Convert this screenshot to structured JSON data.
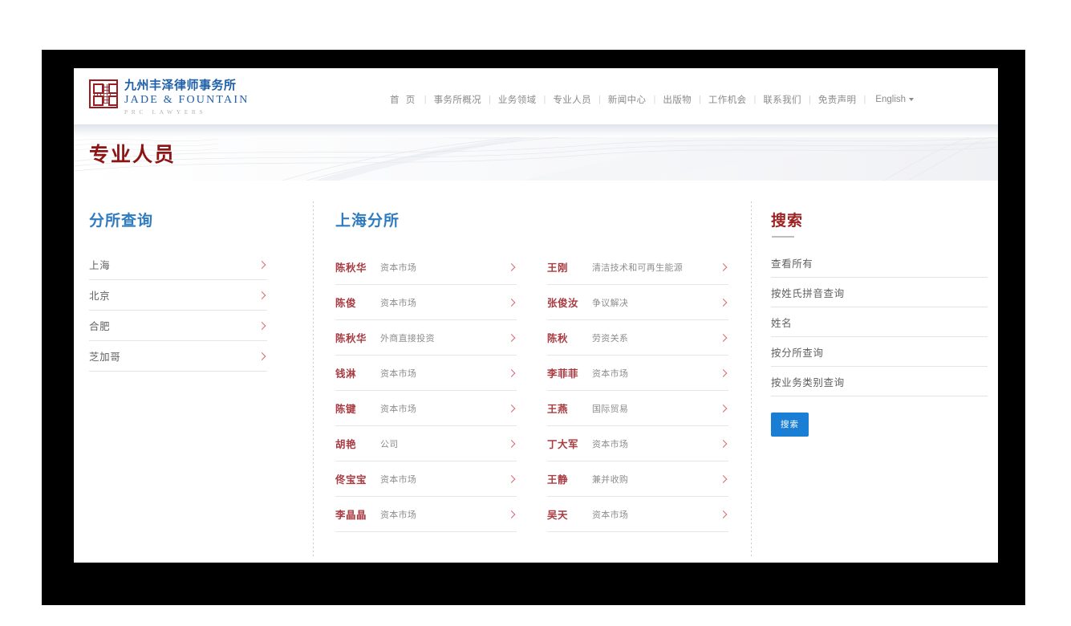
{
  "brand": {
    "seal_icon": "seal-stamp-icon",
    "name_cn": "九州丰泽律师事务所",
    "name_en": "JADE & FOUNTAIN",
    "tagline": "PRC  LAWYERS"
  },
  "nav": {
    "items": [
      {
        "label": "首 页"
      },
      {
        "label": "事务所概况"
      },
      {
        "label": "业务领域"
      },
      {
        "label": "专业人员"
      },
      {
        "label": "新闻中心"
      },
      {
        "label": "出版物"
      },
      {
        "label": "工作机会"
      },
      {
        "label": "联系我们"
      },
      {
        "label": "免责声明"
      }
    ],
    "separator": "|",
    "language": "English"
  },
  "banner": {
    "title": "专业人员"
  },
  "branch_panel": {
    "title": "分所查询",
    "items": [
      {
        "label": "上海"
      },
      {
        "label": "北京"
      },
      {
        "label": "合肥"
      },
      {
        "label": "芝加哥"
      }
    ]
  },
  "lawyers_panel": {
    "title": "上海分所",
    "column_left": [
      {
        "name": "陈秋华",
        "area": "资本市场"
      },
      {
        "name": "陈俊",
        "area": "资本市场"
      },
      {
        "name": "陈秋华",
        "area": "外商直接投资"
      },
      {
        "name": "钱淋",
        "area": "资本市场"
      },
      {
        "name": "陈键",
        "area": "资本市场"
      },
      {
        "name": "胡艳",
        "area": "公司"
      },
      {
        "name": "佟宝宝",
        "area": "资本市场"
      },
      {
        "name": "李晶晶",
        "area": "资本市场"
      }
    ],
    "column_right": [
      {
        "name": "王刚",
        "area": "清洁技术和可再生能源"
      },
      {
        "name": "张俊汝",
        "area": "争议解决"
      },
      {
        "name": "陈秋",
        "area": "劳资关系"
      },
      {
        "name": "李菲菲",
        "area": "资本市场"
      },
      {
        "name": "王燕",
        "area": "国际贸易"
      },
      {
        "name": "丁大军",
        "area": "资本市场"
      },
      {
        "name": "王静",
        "area": "兼并收购"
      },
      {
        "name": "吴天",
        "area": "资本市场"
      }
    ]
  },
  "search_panel": {
    "title": "搜索",
    "options": [
      {
        "label": "查看所有"
      },
      {
        "label": "按姓氏拼音查询"
      },
      {
        "label": "姓名"
      },
      {
        "label": "按分所查询"
      },
      {
        "label": "按业务类别查询"
      }
    ],
    "button_label": "搜索"
  },
  "colors": {
    "brand_blue": "#1e5fa8",
    "heading_blue": "#2f7bbf",
    "brand_red": "#8d1414",
    "name_red": "#a83b41",
    "chevron_red": "#d9686e",
    "button_blue": "#1a7fd4"
  }
}
